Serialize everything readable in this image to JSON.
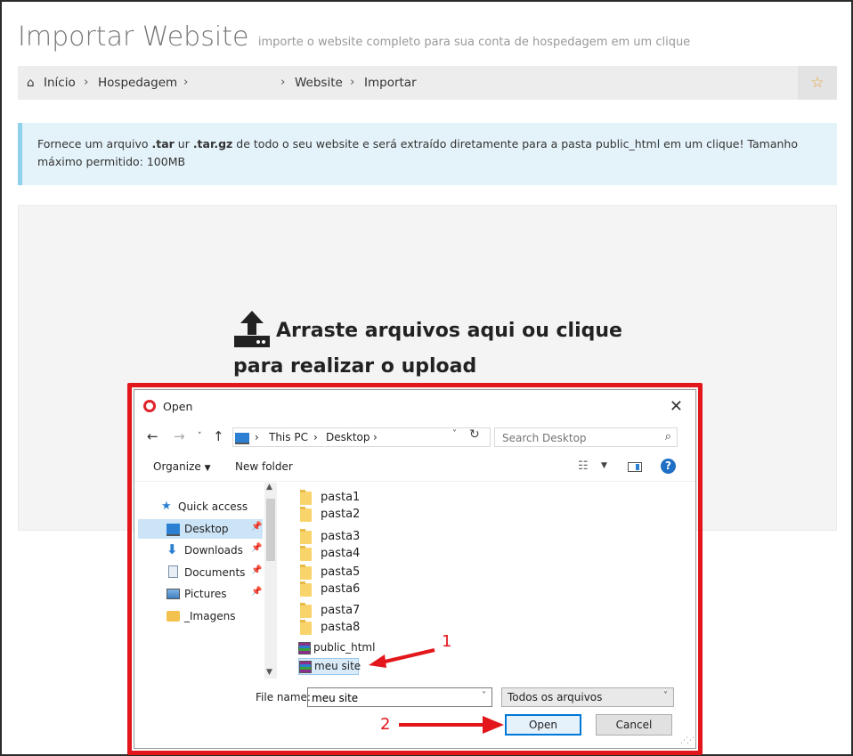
{
  "header": {
    "title": "Importar Website",
    "subtitle": "importe o website completo para sua conta de hospedagem em um clique"
  },
  "breadcrumb": {
    "items": [
      "Início",
      "Hospedagem",
      "Website",
      "Importar"
    ]
  },
  "alert": {
    "part1": "Fornece um arquivo ",
    "ext1": ".tar",
    "part2": " ur ",
    "ext2": ".tar.gz",
    "part3": " de todo o seu website e será extraído diretamente para a pasta public_html em um clique! Tamanho máximo permitido: 100MB"
  },
  "dropzone": {
    "line1": "Arraste arquivos aqui ou clique",
    "line2": "para realizar o upload"
  },
  "dialog": {
    "title": "Open",
    "address": {
      "crumbs": [
        "This PC",
        "Desktop"
      ]
    },
    "search_placeholder": "Search Desktop",
    "toolbar": {
      "organize": "Organize",
      "new_folder": "New folder"
    },
    "nav": [
      {
        "label": "Quick access",
        "pinned": false
      },
      {
        "label": "Desktop",
        "pinned": true,
        "selected": true
      },
      {
        "label": "Downloads",
        "pinned": true
      },
      {
        "label": "Documents",
        "pinned": true
      },
      {
        "label": "Pictures",
        "pinned": true
      },
      {
        "label": "_Imagens",
        "pinned": false
      }
    ],
    "files": [
      {
        "name": "pasta1",
        "type": "folder"
      },
      {
        "name": "pasta2",
        "type": "folder"
      },
      {
        "name": "pasta3",
        "type": "folder"
      },
      {
        "name": "pasta4",
        "type": "folder"
      },
      {
        "name": "pasta5",
        "type": "folder"
      },
      {
        "name": "pasta6",
        "type": "folder"
      },
      {
        "name": "pasta7",
        "type": "folder"
      },
      {
        "name": "pasta8",
        "type": "folder"
      },
      {
        "name": "public_html",
        "type": "rar"
      },
      {
        "name": "meu site",
        "type": "rar",
        "selected": true
      }
    ],
    "file_name_label": "File name:",
    "file_name_value": "meu site",
    "file_type": "Todos os arquivos",
    "open_label": "Open",
    "cancel_label": "Cancel"
  },
  "annotations": {
    "step1": "1",
    "step2": "2",
    "color": "#e3161b"
  }
}
